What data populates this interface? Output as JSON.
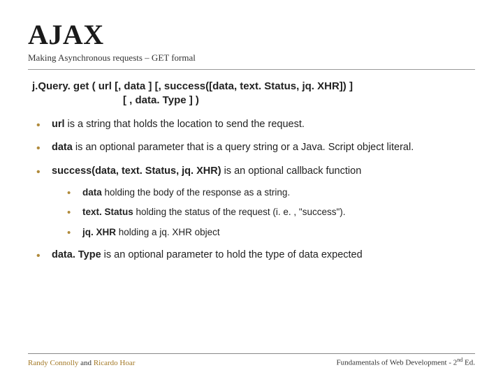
{
  "header": {
    "title": "AJAX",
    "subtitle": "Making Asynchronous requests – GET formal"
  },
  "signature": {
    "line1": "j.Query. get ( url [, data ] [, success([data, text. Status, jq. XHR]) ]",
    "line2": "[ , data. Type ] )"
  },
  "bullets": {
    "url_bold": "url",
    "url_rest": " is a string that holds the location to send the request.",
    "data_bold": "data",
    "data_rest": " is an optional parameter that is a query string or a Java. Script object literal.",
    "success_bold": "success(data, text. Status, jq. XHR)",
    "success_rest": " is an optional callback function",
    "sub_data_bold": "data",
    "sub_data_rest": " holding the body of the response as a string.",
    "sub_status_bold": "text. Status",
    "sub_status_rest": " holding the status of the request (i. e. , \"success\").",
    "sub_jqxhr_bold": "jq. XHR",
    "sub_jqxhr_rest": " holding a jq. XHR object",
    "datatype_bold": "data. Type",
    "datatype_rest": " is an optional parameter to hold the type of data expected"
  },
  "footer": {
    "author1": "Randy Connolly",
    "and": " and ",
    "author2": "Ricardo Hoar",
    "right_pre": "Fundamentals of Web Development - 2",
    "right_sup": "nd",
    "right_post": " Ed."
  }
}
